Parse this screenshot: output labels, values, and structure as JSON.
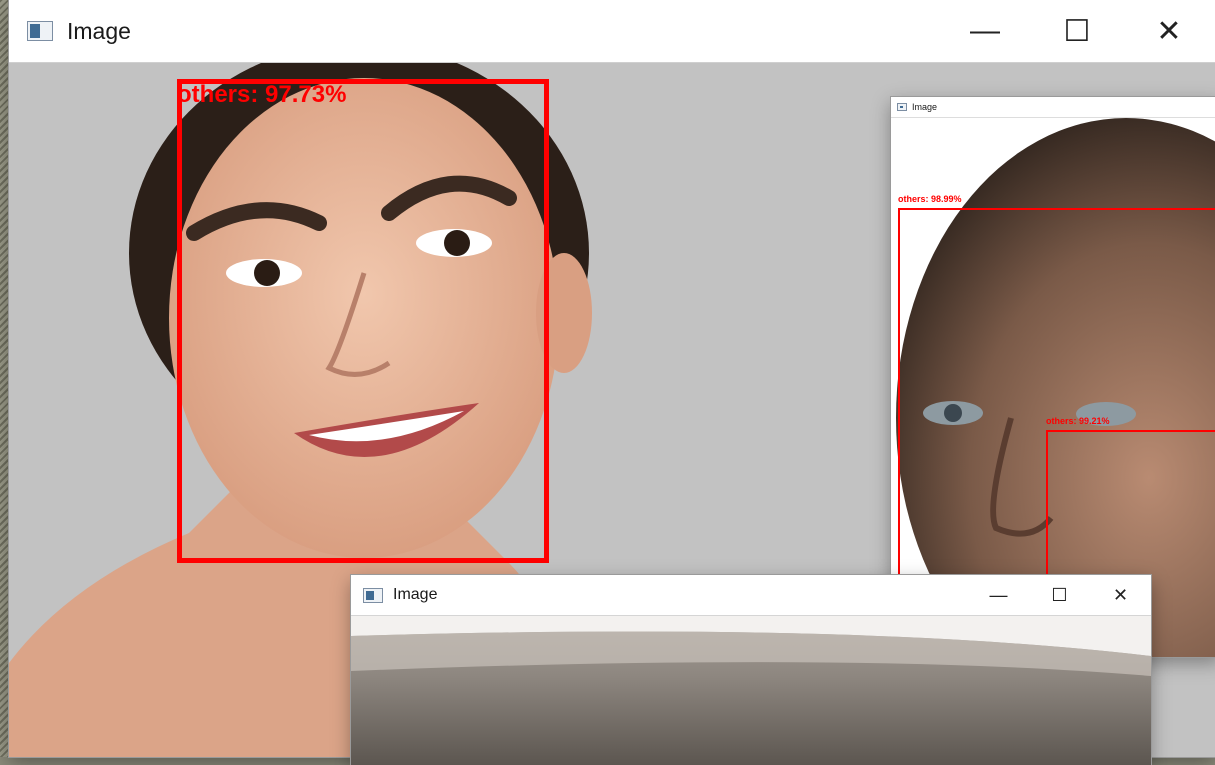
{
  "windows": {
    "main": {
      "title": "Image",
      "icon": "app-window-icon",
      "controls": {
        "minimize": "—",
        "maximize": "☐",
        "close": "✕"
      },
      "detection": {
        "label": "others: 97.73%",
        "color": "#ff0000"
      }
    },
    "right": {
      "title": "Image",
      "icon": "app-window-icon",
      "detections": [
        {
          "label": "others: 98.99%",
          "color": "#ff0000"
        },
        {
          "label": "others: 99.21%",
          "color": "#ff0000"
        }
      ]
    },
    "bottom": {
      "title": "Image",
      "icon": "app-window-icon",
      "controls": {
        "minimize": "—",
        "maximize": "☐",
        "close": "✕"
      }
    }
  }
}
